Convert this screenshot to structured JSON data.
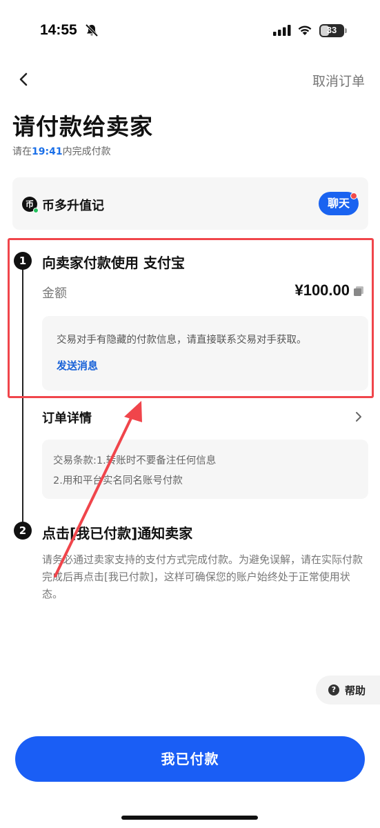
{
  "status_bar": {
    "time": "14:55",
    "battery": "33",
    "icons": [
      "bell-slash-icon",
      "cellular-signal-icon",
      "wifi-icon",
      "battery-icon"
    ]
  },
  "nav": {
    "back_icon": "chevron-left-icon",
    "cancel_label": "取消订单"
  },
  "header": {
    "title": "请付款给卖家",
    "deadline_prefix": "请在",
    "deadline_time": "19:41",
    "deadline_suffix": "内完成付款"
  },
  "seller": {
    "avatar_glyph": "币",
    "name": "币多升值记",
    "chat_label": "聊天"
  },
  "step1": {
    "number": "1",
    "title": "向卖家付款使用 支付宝",
    "amount_label": "金额",
    "amount_value": "¥100.00",
    "hidden_info": "交易对手有隐藏的付款信息，请直接联系交易对手获取。",
    "send_message_label": "发送消息"
  },
  "order_detail": {
    "label": "订单详情",
    "terms_line1": "交易条款:1.转账时不要备注任何信息",
    "terms_line2": "2.用和平台实名同名账号付款"
  },
  "step2": {
    "number": "2",
    "title": "点击[我已付款]通知卖家",
    "description": "请务必通过卖家支持的支付方式完成付款。为避免误解，请在实际付款完成后再点击[我已付款]，这样可确保您的账户始终处于正常使用状态。"
  },
  "help": {
    "icon_glyph": "?",
    "label": "帮助"
  },
  "primary_action": {
    "label": "我已付款"
  },
  "colors": {
    "accent_blue": "#1a5ef5",
    "highlight_red": "#f0454b",
    "online_green": "#23c15e"
  }
}
